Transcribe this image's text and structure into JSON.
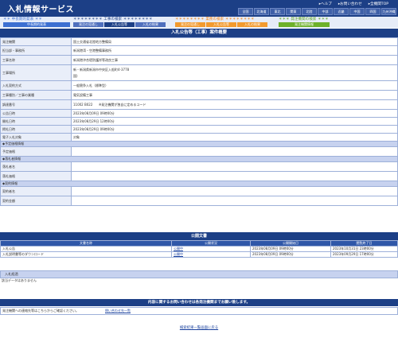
{
  "header": {
    "title": "入札情報サービス",
    "links": [
      "ヘルプ",
      "お問い合わせ",
      "全機関TOP"
    ],
    "regions": [
      "全国",
      "北海道",
      "東北",
      "関東",
      "北陸",
      "中部",
      "近畿",
      "中国",
      "四国",
      "九州沖縄"
    ]
  },
  "nav": {
    "groups": [
      {
        "label": "＊＊ 中長期的発表 ＊＊",
        "color": "#3c6fd1",
        "tabs": [
          {
            "label": "中長期的発表",
            "color": "#3c6fd1"
          }
        ]
      },
      {
        "label": "＊＊＊＊＊＊＊＊ 工事の検索 ＊＊＊＊＊＊＊＊",
        "color": "#1c3f86",
        "tabs": [
          {
            "label": "発注の見通し",
            "color": "#4f6fbd"
          },
          {
            "label": "入札公告等",
            "color": "#1c3f86"
          },
          {
            "label": "入札の結果",
            "color": "#4f6fbd"
          }
        ]
      },
      {
        "label": "＊＊＊＊＊＊＊＊ 業務の検索 ＊＊＊＊＊＊＊＊",
        "color": "#f08010",
        "tabs": [
          {
            "label": "発注の見通し",
            "color": "#f29a2e"
          },
          {
            "label": "入札公告等",
            "color": "#f29a2e"
          },
          {
            "label": "入札の結果",
            "color": "#f29a2e"
          }
        ]
      },
      {
        "label": "＊＊＊ 発注機関の検索 ＊＊＊",
        "color": "#5aa01a",
        "tabs": [
          {
            "label": "発注機関情報",
            "color": "#6db12a"
          }
        ]
      }
    ]
  },
  "detail": {
    "title": "入札公告等（工事）案件概要",
    "rows": [
      {
        "label": "発注機関",
        "value": "国土交通省北陸地方整備局"
      },
      {
        "label": "担当部・事務所",
        "value": "新潟港湾・空港整備事務所"
      },
      {
        "label": "工事名称",
        "value": "新潟港沖合堤防護岸等改良工事"
      },
      {
        "label": "工事場所",
        "value": "新・新潟県新潟市中央区入船町4-3778",
        "value2": "国)"
      },
      {
        "label": "入札契約方式",
        "value": "一般競争入札（標準型）"
      },
      {
        "label": "工事種別／工事の業種",
        "value": "電気設備工事"
      },
      {
        "label": "調達番号",
        "value": "11002 B022",
        "value2": "※発注機関が独自に定めるコード"
      },
      {
        "label": "公告日時",
        "value": "2023年08月09日 09時00分"
      },
      {
        "label": "開札日時",
        "value": "2023年08月29日 12時00分"
      },
      {
        "label": "掲札日時",
        "value": "2023年08月29日 09時00分"
      },
      {
        "label": "電子入札対象",
        "value": "対象"
      }
    ],
    "sections": {
      "price": "◆予定価格情報",
      "winner": "◆落札者情報",
      "contract": "◆契約情報"
    },
    "price_rows": [
      {
        "label": "予定価格",
        "value": ""
      }
    ],
    "winner_rows": [
      {
        "label": "落札者名",
        "value": ""
      },
      {
        "label": "落札価格",
        "value": ""
      }
    ],
    "contract_rows": [
      {
        "label": "契約者名",
        "value": ""
      },
      {
        "label": "契約金額",
        "value": ""
      }
    ]
  },
  "docs": {
    "title": "公開文書",
    "columns": [
      "文書名称",
      "公開状況",
      "公開開始日",
      "閲覧終了日"
    ],
    "rows": [
      {
        "name": "入札公告",
        "status": "公開中",
        "start": "2023年08月09日 09時00分",
        "end": "2023年10月31日 23時00分"
      },
      {
        "name": "入札説明書等のダウンロード",
        "status": "公開中",
        "start": "2023年08月09日 09時00分",
        "end": "2023年09月29日 17時00分"
      }
    ]
  },
  "history": {
    "title": "入札経過",
    "empty": "該当データはありません"
  },
  "contact": {
    "bar": "内容に関するお問い合わせは各発注機関までお願い致します。",
    "label": "発注機関への連絡先等はこちらからご確認ください。",
    "link": "問い合わせ先一覧"
  },
  "back_link": "検索結果一覧画面に戻る"
}
